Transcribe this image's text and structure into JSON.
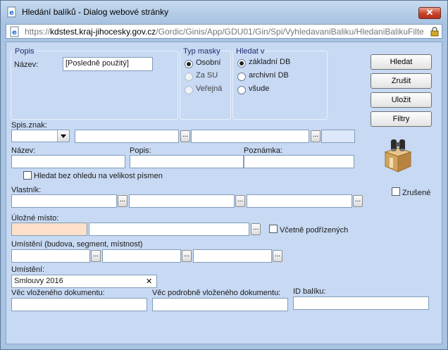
{
  "window": {
    "title": "Hledání balíků - Dialog webové stránky",
    "close_label": "✕",
    "address": {
      "prefix": "https://",
      "domain": "kdstest.kraj-jihocesky.gov.cz",
      "path": "/Gordic/Ginis/App/GDU01/Gin/Spi/VyhledavaniBaliku/HledaniBalikuFilte"
    }
  },
  "popis_group": {
    "legend": "Popis",
    "nazev_label": "Název:",
    "nazev_value": "[Posledně použitý]"
  },
  "typ_masky": {
    "legend": "Typ masky",
    "options": [
      "Osobní",
      "Za SU",
      "Veřejná"
    ],
    "selected": "Osobní"
  },
  "hledat_v": {
    "legend": "Hledat v",
    "options": [
      "základní DB",
      "archivní DB",
      "všude"
    ],
    "selected": "základní DB"
  },
  "buttons": {
    "hledat": "Hledat",
    "zrusit": "Zrušit",
    "ulozit": "Uložit",
    "filtry": "Filtry"
  },
  "fields": {
    "spis_znak": "Spis.znak:",
    "nazev": "Název:",
    "popis": "Popis:",
    "poznamka": "Poznámka:",
    "hledat_bez_ohledu": "Hledat bez ohledu na velikost písmen",
    "vlastnik": "Vlastník:",
    "zrusene": "Zrušené",
    "ulozne_misto": "Úložné místo:",
    "vcetne_podrizenych": "Včetně podřízených",
    "umisteni_bsm": "Umístění (budova, segment, místnost)",
    "umisteni": "Umístění:",
    "umisteni_value": "Smlouvy 2016",
    "vec_vlozeneho": "Věc vloženého dokumentu:",
    "vec_podrobne": "Věc podrobně vloženého dokumentu:",
    "id_baliku": "ID balíku:"
  },
  "dots_label": "...",
  "clear_label": "✕",
  "icons": {
    "title": "ie-page-icon",
    "address": "ie-page-icon",
    "lock": "lock-icon",
    "search_graphic": "binoculars-box-icon"
  }
}
